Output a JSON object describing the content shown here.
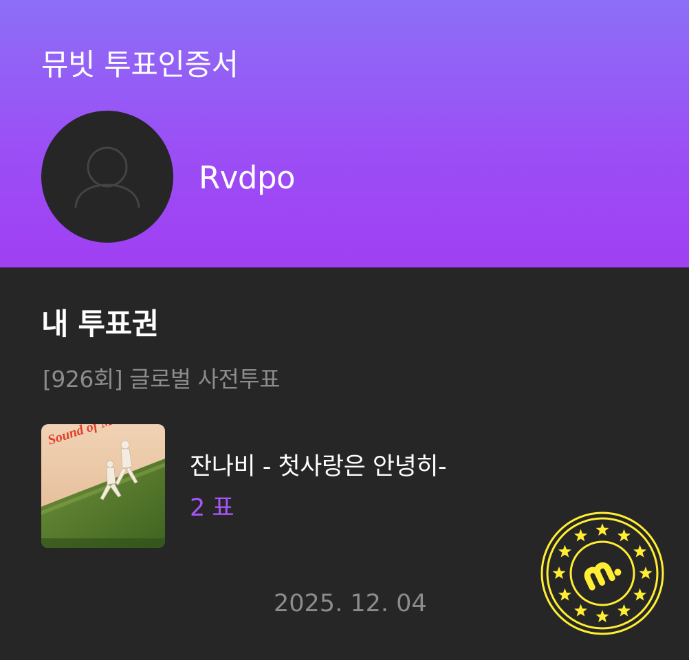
{
  "header": {
    "title": "뮤빗 투표인증서",
    "username": "Rvdpo",
    "avatar_icon": "person-placeholder-icon"
  },
  "votes": {
    "section_title": "내 투표권",
    "round_label": "[926회] 글로벌 사전투표",
    "item": {
      "song": "잔나비 - 첫사랑은 안녕히-",
      "count": "2 표",
      "album_art_text": "Sound of Music"
    },
    "date": "2025. 12. 04"
  },
  "stamp": {
    "icon": "mubeat-stamp-icon"
  },
  "colors": {
    "header_gradient_top": "#8c6ff7",
    "header_gradient_bottom": "#a03ff3",
    "background": "#262626",
    "vote_accent": "#a855f7",
    "stamp_yellow": "#ffee33"
  }
}
